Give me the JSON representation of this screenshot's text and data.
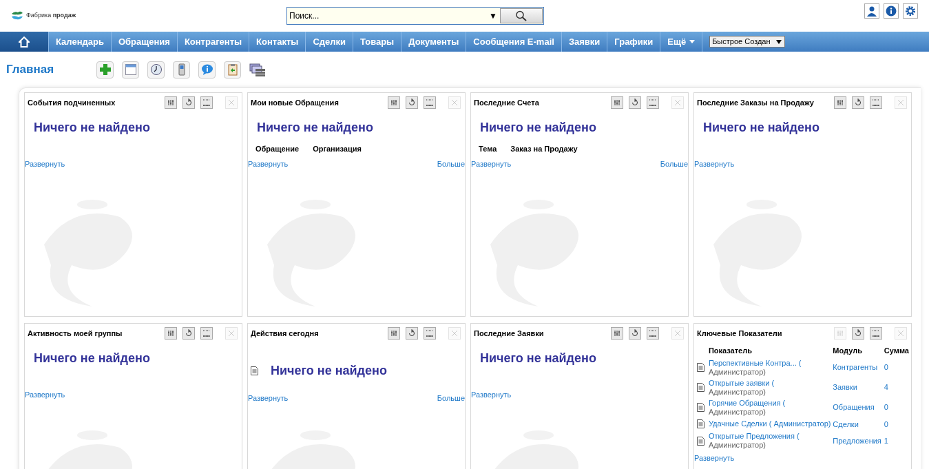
{
  "logo": {
    "text": "Фабрика **продаж**"
  },
  "search": {
    "placeholder": "Поиск...",
    "dropdown": "▼"
  },
  "nav": {
    "items": [
      {
        "label": "Календарь",
        "kind": "link"
      },
      {
        "label": "Обращения",
        "kind": "link"
      },
      {
        "label": "Контрагенты",
        "kind": "link"
      },
      {
        "label": "Контакты",
        "kind": "link"
      },
      {
        "label": "Сделки",
        "kind": "link"
      },
      {
        "label": "Товары",
        "kind": "link"
      },
      {
        "label": "Документы",
        "kind": "link"
      },
      {
        "label": "Сообщения E-mail",
        "kind": "link"
      },
      {
        "label": "Заявки",
        "kind": "link"
      },
      {
        "label": "Графики",
        "kind": "link"
      },
      {
        "label": "Ещё",
        "kind": "menu"
      }
    ],
    "quick_create": "Быстрое Создан"
  },
  "page_title": "Главная",
  "widgets": [
    {
      "title": "События подчиненных",
      "edit_enabled": true,
      "empty": "Ничего не найдено",
      "expand": "Развернуть"
    },
    {
      "title": "Мои новые Обращения",
      "edit_enabled": true,
      "empty": "Ничего не найдено",
      "headers": [
        "Обращение",
        "Организация"
      ],
      "expand": "Развернуть",
      "more": "Больше"
    },
    {
      "title": "Последние Счета",
      "edit_enabled": true,
      "empty": "Ничего не найдено",
      "headers": [
        "Тема",
        "Заказ на Продажу"
      ],
      "expand": "Развернуть",
      "more": "Больше"
    },
    {
      "title": "Последние Заказы на Продажу",
      "edit_enabled": true,
      "empty": "Ничего не найдено",
      "expand": "Развернуть"
    },
    {
      "title": "Активность моей группы",
      "edit_enabled": true,
      "empty": "Ничего не найдено",
      "expand": "Развернуть"
    },
    {
      "title": "Действия сегодня",
      "edit_enabled": true,
      "empty": "Ничего не найдено",
      "empty_icon": true,
      "expand": "Развернуть",
      "more": "Больше"
    },
    {
      "title": "Последние Заявки",
      "edit_enabled": true,
      "empty": "Ничего не найдено",
      "expand": "Развернуть"
    },
    {
      "title": "Ключевые Показатели",
      "edit_enabled": false,
      "kpi": {
        "columns": [
          "Показатель",
          "Модуль",
          "Сумма"
        ],
        "rows": [
          {
            "name": "Перспективные Контра... (",
            "owner": "Администратор)",
            "module": "Контрагенты",
            "sum": "0"
          },
          {
            "name": "Открытые заявки (",
            "owner": "Администратор)",
            "module": "Заявки",
            "sum": "4"
          },
          {
            "name": "Горячие Обращения (",
            "owner": "Администратор)",
            "module": "Обращения",
            "sum": "0"
          },
          {
            "name": "Удачные Сделки ( Администратор)",
            "module": "Сделки",
            "sum": "0"
          },
          {
            "name": "Открытые Предложения (",
            "owner": "Администратор)",
            "module": "Предложения",
            "sum": "1"
          }
        ]
      },
      "expand": "Развернуть"
    }
  ]
}
